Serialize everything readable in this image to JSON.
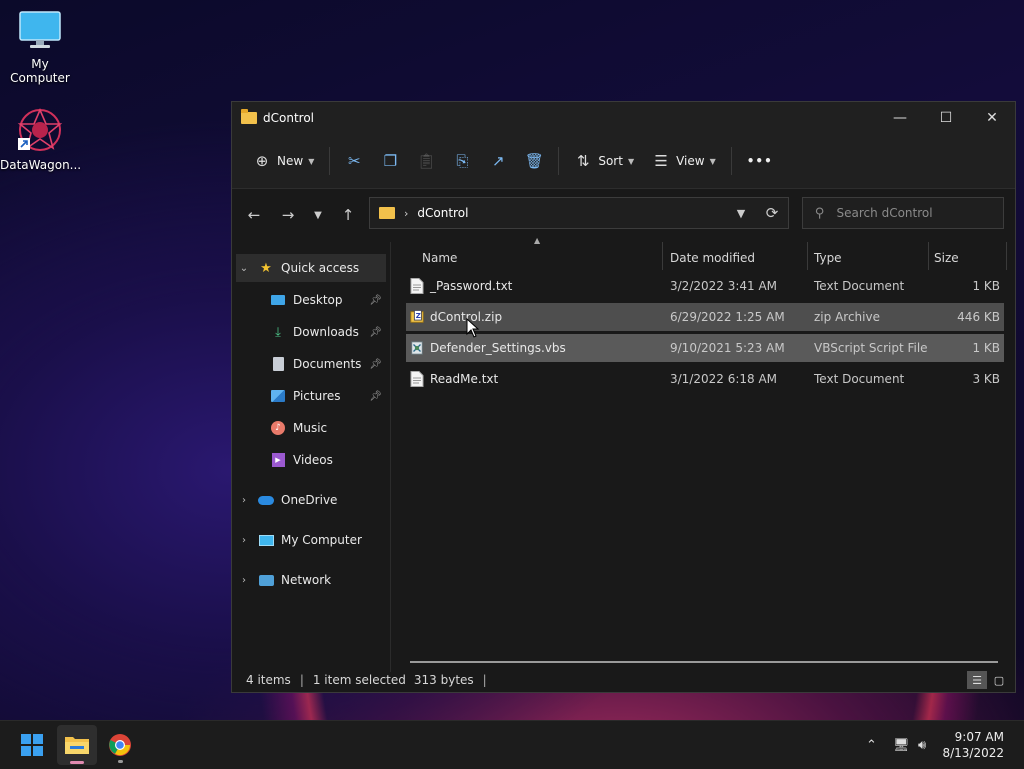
{
  "desktop": {
    "icons": [
      {
        "label": "My Computer",
        "icon": "monitor-icon"
      },
      {
        "label": "DataWagon...",
        "icon": "datawagon-shortcut-icon"
      }
    ]
  },
  "window": {
    "title": "dControl",
    "controls": {
      "minimize": "—",
      "maximize": "☐",
      "close": "✕"
    }
  },
  "commandbar": {
    "new_label": "New",
    "sort_label": "Sort",
    "view_label": "View",
    "more_label": "•••"
  },
  "address": {
    "path": "dControl",
    "search_placeholder": "Search dControl"
  },
  "sidebar": {
    "quick_access": "Quick access",
    "items": [
      {
        "label": "Desktop",
        "pinned": true,
        "icon": "desktop-folder-icon"
      },
      {
        "label": "Downloads",
        "pinned": true,
        "icon": "downloads-icon"
      },
      {
        "label": "Documents",
        "pinned": true,
        "icon": "documents-icon"
      },
      {
        "label": "Pictures",
        "pinned": true,
        "icon": "pictures-icon"
      },
      {
        "label": "Music",
        "pinned": false,
        "icon": "music-icon"
      },
      {
        "label": "Videos",
        "pinned": false,
        "icon": "videos-icon"
      }
    ],
    "onedrive": "OneDrive",
    "my_computer": "My Computer",
    "network": "Network"
  },
  "columns": {
    "name": "Name",
    "date": "Date modified",
    "type": "Type",
    "size": "Size"
  },
  "files": [
    {
      "name": "_Password.txt",
      "date": "3/2/2022 3:41 AM",
      "type": "Text Document",
      "size": "1 KB",
      "icon": "text-file-icon"
    },
    {
      "name": "dControl.zip",
      "date": "6/29/2022 1:25 AM",
      "type": "zip Archive",
      "size": "446 KB",
      "icon": "zip-archive-icon"
    },
    {
      "name": "Defender_Settings.vbs",
      "date": "9/10/2021 5:23 AM",
      "type": "VBScript Script File",
      "size": "1 KB",
      "icon": "vbscript-file-icon"
    },
    {
      "name": "ReadMe.txt",
      "date": "3/1/2022 6:18 AM",
      "type": "Text Document",
      "size": "3 KB",
      "icon": "text-file-icon"
    }
  ],
  "status": {
    "items": "4 items",
    "selection": "1 item selected",
    "bytes": "313 bytes"
  },
  "taskbar": {
    "time": "9:07 AM",
    "date": "8/13/2022"
  }
}
